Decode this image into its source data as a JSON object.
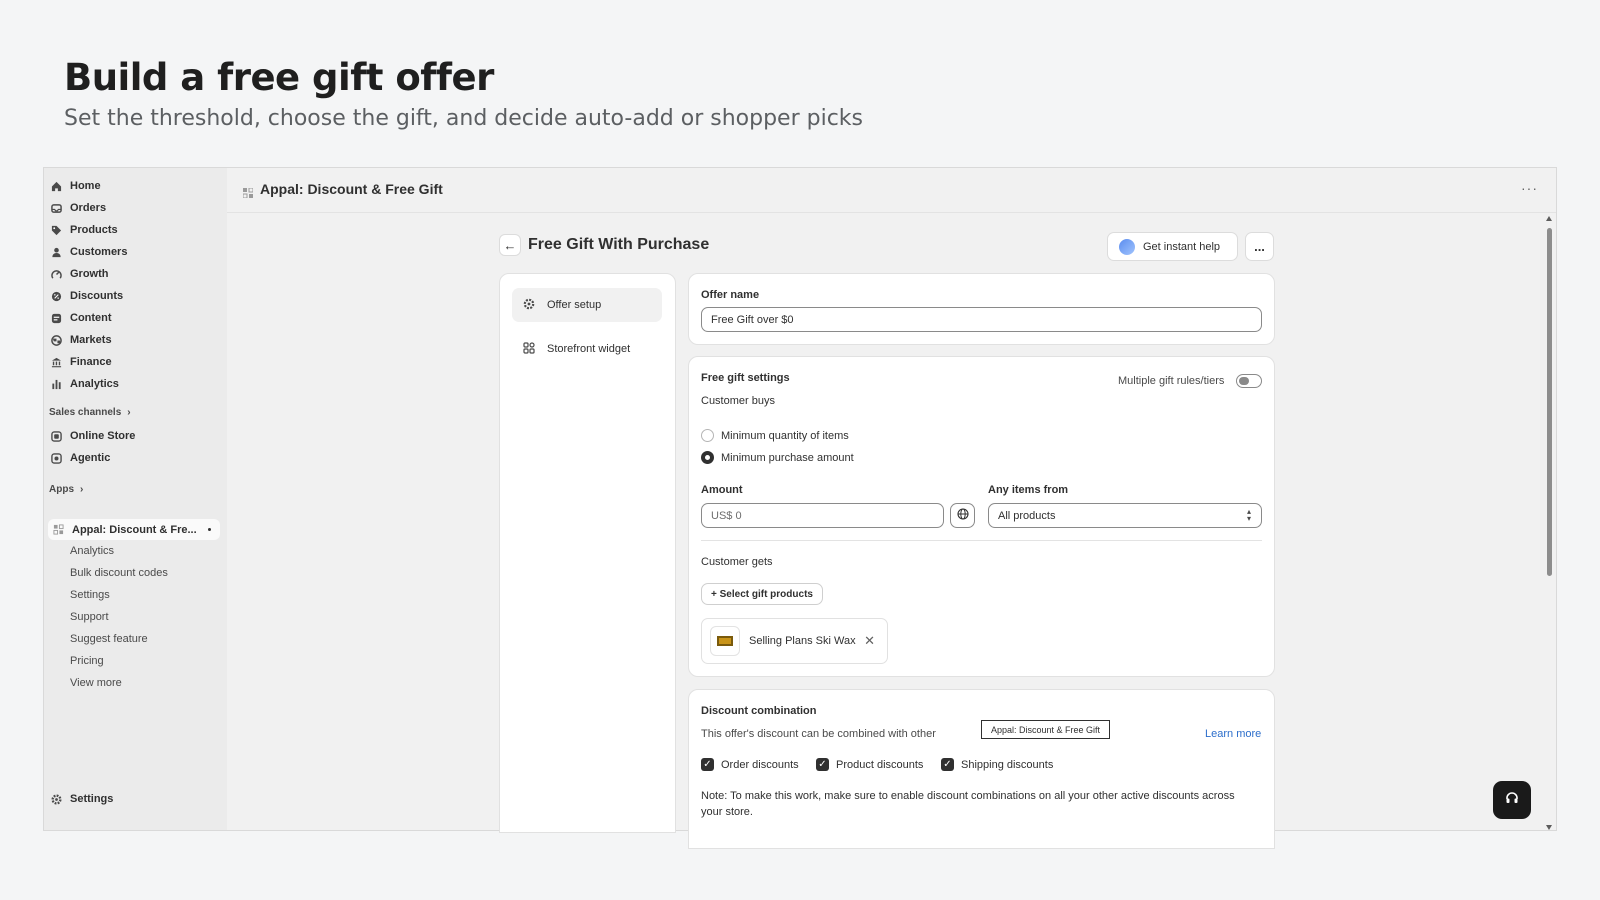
{
  "hero": {
    "title": "Build a free gift offer",
    "subtitle": "Set the threshold, choose the gift, and decide auto-add or shopper picks"
  },
  "sidebar": {
    "items": [
      {
        "label": "Home",
        "icon": "home-icon"
      },
      {
        "label": "Orders",
        "icon": "inbox-icon"
      },
      {
        "label": "Products",
        "icon": "tag-icon"
      },
      {
        "label": "Customers",
        "icon": "person-icon"
      },
      {
        "label": "Growth",
        "icon": "growth-icon"
      },
      {
        "label": "Discounts",
        "icon": "discount-icon"
      },
      {
        "label": "Content",
        "icon": "content-icon"
      },
      {
        "label": "Markets",
        "icon": "globe-icon"
      },
      {
        "label": "Finance",
        "icon": "bank-icon"
      },
      {
        "label": "Analytics",
        "icon": "bar-chart-icon"
      }
    ],
    "sales_channels_label": "Sales channels",
    "channels": [
      {
        "label": "Online Store"
      },
      {
        "label": "Agentic"
      }
    ],
    "apps_label": "Apps",
    "active_app": "Appal: Discount & Fre...",
    "app_subitems": [
      "Analytics",
      "Bulk discount codes",
      "Settings",
      "Support",
      "Suggest feature",
      "Pricing",
      "View more"
    ],
    "settings_label": "Settings"
  },
  "topbar": {
    "app_title": "Appal: Discount & Free Gift",
    "more": "···"
  },
  "page": {
    "title": "Free Gift With Purchase",
    "help_label": "Get instant help",
    "more_label": "..."
  },
  "side_nav": {
    "items": [
      {
        "label": "Offer setup"
      },
      {
        "label": "Storefront widget"
      }
    ]
  },
  "offer_name": {
    "label": "Offer name",
    "value": "Free Gift over $0"
  },
  "gift_settings": {
    "title": "Free gift settings",
    "multiple_toggle_label": "Multiple gift rules/tiers",
    "customer_buys": "Customer buys",
    "options": [
      "Minimum quantity of items",
      "Minimum purchase amount"
    ],
    "selected_option": "Minimum purchase amount",
    "amount_label": "Amount",
    "amount_value": "US$ 0",
    "any_items_label": "Any items from",
    "any_items_value": "All products",
    "customer_gets": "Customer gets",
    "select_gift_button": "+ Select gift products",
    "gift_product": "Selling Plans Ski Wax"
  },
  "discount_combination": {
    "title": "Discount combination",
    "description": "This offer's discount can be combined with other",
    "tooltip": "Appal: Discount & Free Gift",
    "learn_more": "Learn more",
    "checkboxes": [
      "Order discounts",
      "Product discounts",
      "Shipping discounts"
    ],
    "note": "Note: To make this work, make sure to enable discount combinations on all your other active discounts across your store."
  },
  "colors": {
    "page_bg": "#f4f5f6",
    "sidebar_bg": "#ebebeb",
    "link": "#2c6ecb",
    "text": "#303030"
  }
}
